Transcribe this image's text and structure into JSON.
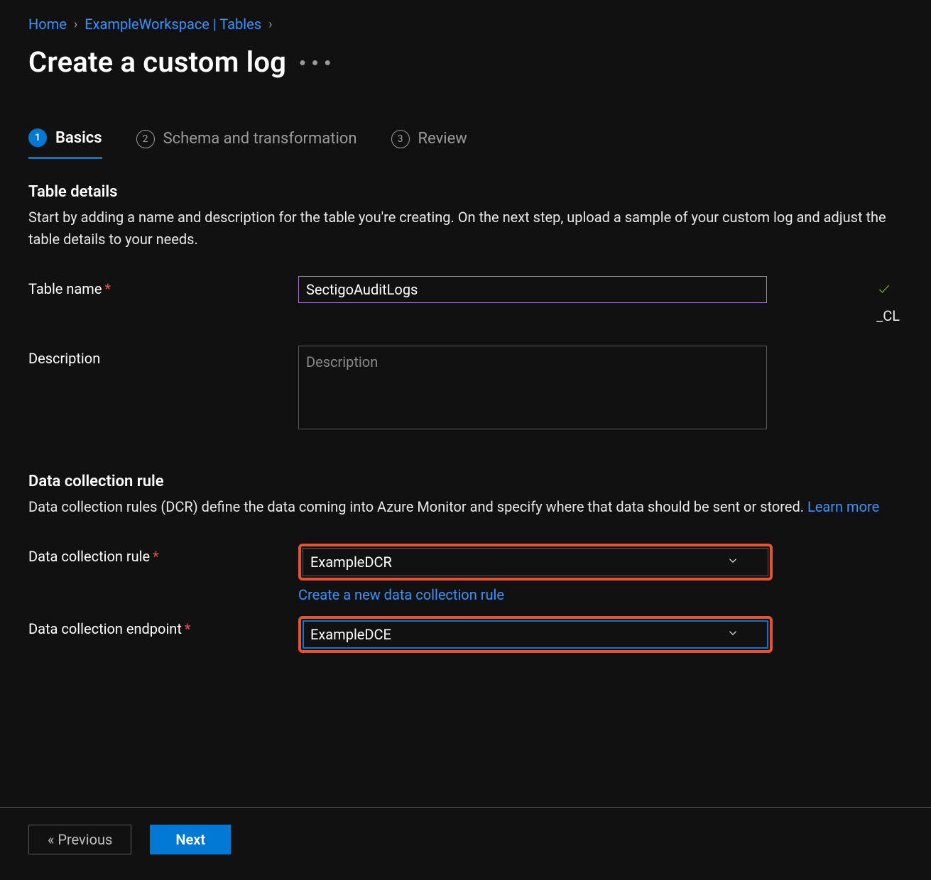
{
  "breadcrumb": {
    "home": "Home",
    "workspace": "ExampleWorkspace | Tables"
  },
  "title": "Create a custom log",
  "tabs": {
    "basics": "Basics",
    "schema": "Schema and transformation",
    "review": "Review"
  },
  "tableDetails": {
    "heading": "Table details",
    "desc": "Start by adding a name and description for the table you're creating. On the next step, upload a sample of your custom log and adjust the table details to your needs.",
    "tableNameLabel": "Table name",
    "tableNameValue": "SectigoAuditLogs",
    "suffix": "_CL",
    "descriptionLabel": "Description",
    "descriptionPlaceholder": "Description",
    "descriptionValue": ""
  },
  "dcr": {
    "heading": "Data collection rule",
    "desc": "Data collection rules (DCR) define the data coming into Azure Monitor and specify where that data should be sent or stored. ",
    "learnMore": "Learn more",
    "ruleLabel": "Data collection rule",
    "ruleValue": "ExampleDCR",
    "newRuleLink": "Create a new data collection rule",
    "endpointLabel": "Data collection endpoint",
    "endpointValue": "ExampleDCE"
  },
  "footer": {
    "previous": "« Previous",
    "next": "Next"
  }
}
